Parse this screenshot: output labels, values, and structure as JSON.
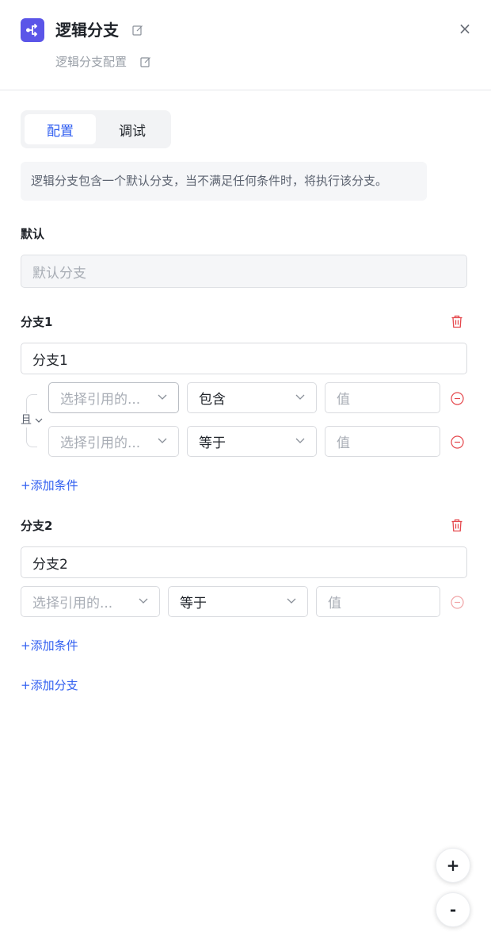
{
  "header": {
    "title": "逻辑分支",
    "subtitle": "逻辑分支配置",
    "close_label": "×",
    "icon": "branch-node-icon",
    "accent": "#5b55e8"
  },
  "tabs": [
    {
      "label": "配置",
      "active": true
    },
    {
      "label": "调试",
      "active": false
    }
  ],
  "info_text": "逻辑分支包含一个默认分支，当不满足任何条件时，将执行该分支。",
  "default_branch": {
    "label": "默认",
    "value": "默认分支"
  },
  "branches": [
    {
      "label": "分支1",
      "name_value": "分支1",
      "logic": "且",
      "conditions": [
        {
          "field_placeholder": "选择引用的...",
          "operator": "包含",
          "value_placeholder": "值"
        },
        {
          "field_placeholder": "选择引用的...",
          "operator": "等于",
          "value_placeholder": "值"
        }
      ],
      "add_condition": "+添加条件"
    },
    {
      "label": "分支2",
      "name_value": "分支2",
      "conditions": [
        {
          "field_placeholder": "选择引用的...",
          "operator": "等于",
          "value_placeholder": "值"
        }
      ],
      "add_condition": "+添加条件"
    }
  ],
  "add_branch": "+添加分支",
  "zoom": {
    "in": "+",
    "out": "-"
  },
  "colors": {
    "link": "#2f5ef0",
    "danger": "#e5484d"
  }
}
